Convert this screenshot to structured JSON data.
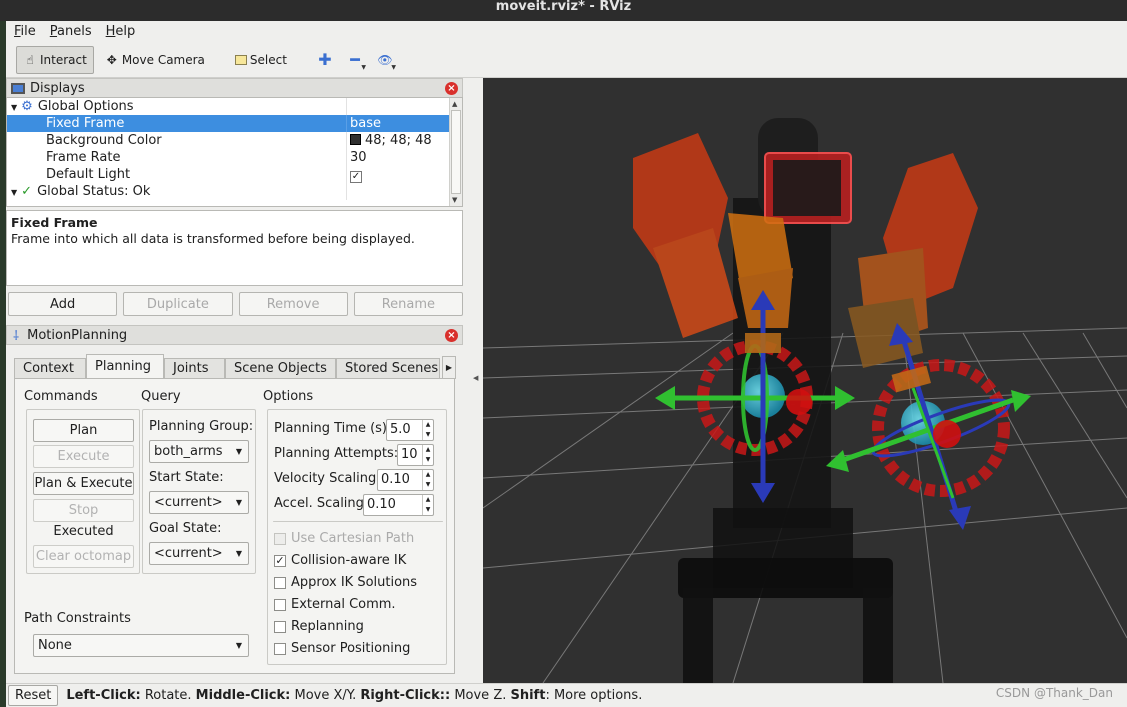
{
  "window": {
    "title": "moveit.rviz* - RViz"
  },
  "menu": [
    "File",
    "Panels",
    "Help"
  ],
  "toolbar": {
    "interact": "Interact",
    "move_camera": "Move Camera",
    "select": "Select"
  },
  "displays": {
    "title": "Displays",
    "rows": [
      {
        "label": "Global Options",
        "value": ""
      },
      {
        "label": "Fixed Frame",
        "value": "base"
      },
      {
        "label": "Background Color",
        "value": "48; 48; 48"
      },
      {
        "label": "Frame Rate",
        "value": "30"
      },
      {
        "label": "Default Light",
        "value": "✓"
      },
      {
        "label": "Global Status: Ok",
        "value": ""
      }
    ],
    "bg_color_hex": "#303030",
    "description_title": "Fixed Frame",
    "description_text": "Frame into which all data is transformed before being displayed.",
    "buttons": [
      "Add",
      "Duplicate",
      "Remove",
      "Rename"
    ]
  },
  "motion_planning": {
    "title": "MotionPlanning",
    "tabs": [
      "Context",
      "Planning",
      "Joints",
      "Scene Objects",
      "Stored Scenes"
    ],
    "commands": {
      "title": "Commands",
      "plan": "Plan",
      "execute": "Execute",
      "plan_execute": "Plan & Execute",
      "stop": "Stop",
      "status": "Executed",
      "clear_octomap": "Clear octomap"
    },
    "query": {
      "title": "Query",
      "planning_group_label": "Planning Group:",
      "planning_group": "both_arms",
      "start_state_label": "Start State:",
      "start_state": "<current>",
      "goal_state_label": "Goal State:",
      "goal_state": "<current>"
    },
    "options": {
      "title": "Options",
      "planning_time_label": "Planning Time (s):",
      "planning_time": "5.0",
      "planning_attempts_label": "Planning Attempts:",
      "planning_attempts": "10",
      "velocity_label": "Velocity Scaling:",
      "velocity": "0.10",
      "accel_label": "Accel. Scaling:",
      "accel": "0.10",
      "checks": [
        {
          "label": "Use Cartesian Path",
          "checked": false,
          "disabled": true
        },
        {
          "label": "Collision-aware IK",
          "checked": true,
          "disabled": false
        },
        {
          "label": "Approx IK Solutions",
          "checked": false,
          "disabled": false
        },
        {
          "label": "External Comm.",
          "checked": false,
          "disabled": false
        },
        {
          "label": "Replanning",
          "checked": false,
          "disabled": false
        },
        {
          "label": "Sensor Positioning",
          "checked": false,
          "disabled": false
        }
      ]
    },
    "path_constraints_label": "Path Constraints",
    "path_constraints": "None"
  },
  "status": {
    "reset": "Reset",
    "left_key": "Left-Click:",
    "left_text": " Rotate. ",
    "middle_key": "Middle-Click:",
    "middle_text": " Move X/Y. ",
    "right_key": "Right-Click::",
    "right_text": " Move Z. ",
    "shift_key": "Shift",
    "shift_text": ": More options."
  },
  "watermark": "CSDN @Thank_Dan"
}
